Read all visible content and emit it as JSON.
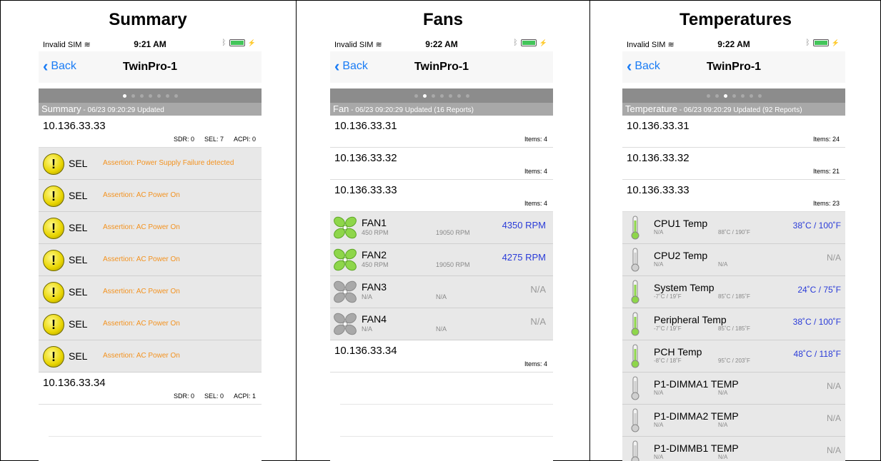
{
  "columns": [
    {
      "title": "Summary"
    },
    {
      "title": "Fans"
    },
    {
      "title": "Temperatures"
    }
  ],
  "phones": [
    {
      "status": {
        "carrier": "Invalid SIM",
        "time": "9:21 AM"
      },
      "nav": {
        "back": "Back",
        "title": "TwinPro-1"
      },
      "pager": {
        "count": 7,
        "active": 0
      },
      "header": {
        "title": "Summary",
        "sub": " - 06/23 09:20:29 Updated"
      }
    },
    {
      "status": {
        "carrier": "Invalid SIM",
        "time": "9:22 AM"
      },
      "nav": {
        "back": "Back",
        "title": "TwinPro-1"
      },
      "pager": {
        "count": 7,
        "active": 1
      },
      "header": {
        "title": "Fan",
        "sub": " - 06/23 09:20:29 Updated (16 Reports)"
      }
    },
    {
      "status": {
        "carrier": "Invalid SIM",
        "time": "9:22 AM"
      },
      "nav": {
        "back": "Back",
        "title": "TwinPro-1"
      },
      "pager": {
        "count": 7,
        "active": 2
      },
      "header": {
        "title": "Temperature",
        "sub": " - 06/23 09:20:29 Updated (92 Reports)"
      }
    }
  ],
  "summary": {
    "hosts": [
      {
        "ip": "10.136.33.33",
        "sdr": "SDR:  0",
        "sel": "SEL:  7",
        "acpi": "ACPI:  0"
      },
      {
        "ip": "10.136.33.34",
        "sdr": "SDR:  0",
        "sel": "SEL:  0",
        "acpi": "ACPI:  1"
      }
    ],
    "events": [
      {
        "type": "SEL",
        "message": "Assertion: Power Supply Failure detected"
      },
      {
        "type": "SEL",
        "message": "Assertion: AC Power On"
      },
      {
        "type": "SEL",
        "message": "Assertion: AC Power On"
      },
      {
        "type": "SEL",
        "message": "Assertion: AC Power On"
      },
      {
        "type": "SEL",
        "message": "Assertion: AC Power On"
      },
      {
        "type": "SEL",
        "message": "Assertion: AC Power On"
      },
      {
        "type": "SEL",
        "message": "Assertion: AC Power On"
      }
    ]
  },
  "fans": {
    "hosts": [
      {
        "ip": "10.136.33.31",
        "items": "Items: 4"
      },
      {
        "ip": "10.136.33.32",
        "items": "Items: 4"
      },
      {
        "ip": "10.136.33.33",
        "items": "Items: 4"
      },
      {
        "ip": "10.136.33.34",
        "items": "Items: 4"
      }
    ],
    "sensors": [
      {
        "name": "FAN1",
        "min": "450 RPM",
        "max": "19050 RPM",
        "value": "4350 RPM",
        "active": true
      },
      {
        "name": "FAN2",
        "min": "450 RPM",
        "max": "19050 RPM",
        "value": "4275 RPM",
        "active": true
      },
      {
        "name": "FAN3",
        "min": "N/A",
        "max": "N/A",
        "value": "N/A",
        "active": false
      },
      {
        "name": "FAN4",
        "min": "N/A",
        "max": "N/A",
        "value": "N/A",
        "active": false
      }
    ]
  },
  "temperatures": {
    "hosts": [
      {
        "ip": "10.136.33.31",
        "items": "Items: 24"
      },
      {
        "ip": "10.136.33.32",
        "items": "Items: 21"
      },
      {
        "ip": "10.136.33.33",
        "items": "Items: 23"
      }
    ],
    "sensors": [
      {
        "name": "CPU1 Temp",
        "min": "N/A",
        "max": "88˚C / 190˚F",
        "value": "38˚C / 100˚F",
        "active": true
      },
      {
        "name": "CPU2 Temp",
        "min": "N/A",
        "max": "N/A",
        "value": "N/A",
        "active": false
      },
      {
        "name": "System Temp",
        "min": "-7˚C / 19˚F",
        "max": "85˚C / 185˚F",
        "value": "24˚C / 75˚F",
        "active": true
      },
      {
        "name": "Peripheral Temp",
        "min": "-7˚C / 19˚F",
        "max": "85˚C / 185˚F",
        "value": "38˚C / 100˚F",
        "active": true
      },
      {
        "name": "PCH Temp",
        "min": "-8˚C / 18˚F",
        "max": "95˚C / 203˚F",
        "value": "48˚C / 118˚F",
        "active": true
      },
      {
        "name": "P1-DIMMA1 TEMP",
        "min": "N/A",
        "max": "N/A",
        "value": "N/A",
        "active": false
      },
      {
        "name": "P1-DIMMA2 TEMP",
        "min": "N/A",
        "max": "N/A",
        "value": "N/A",
        "active": false
      },
      {
        "name": "P1-DIMMB1 TEMP",
        "min": "N/A",
        "max": "N/A",
        "value": "N/A",
        "active": false
      }
    ]
  },
  "colors": {
    "accent": "#1a7cf5",
    "warning_text": "#f3921f",
    "value_text": "#2a3bd8",
    "header_bg": "#a8a8a8",
    "pager_bg": "#8c8c8c"
  }
}
